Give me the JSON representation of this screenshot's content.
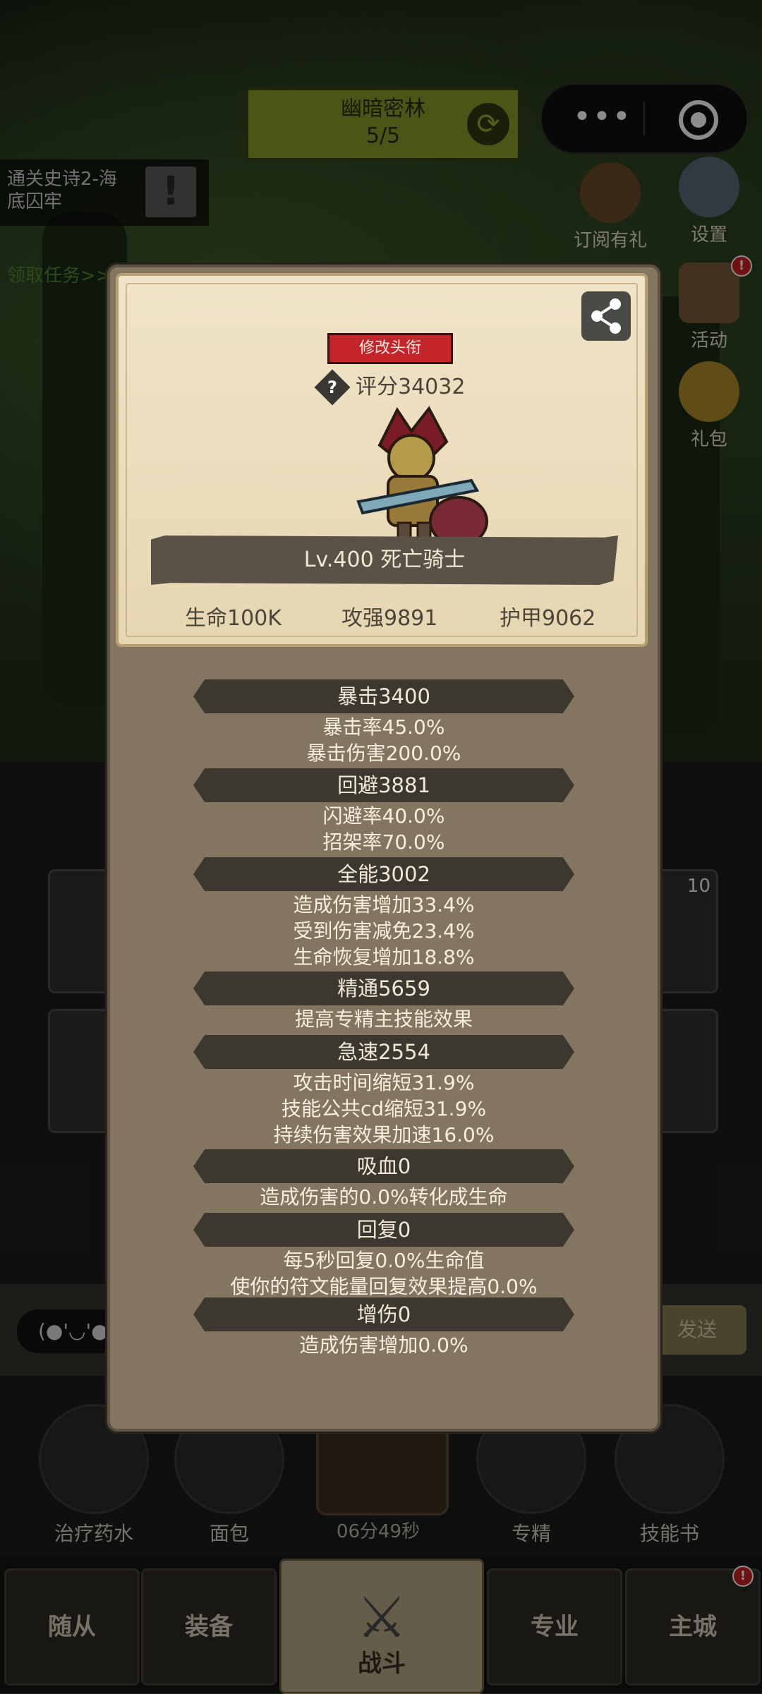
{
  "stage": {
    "name": "幽暗密林",
    "progress": "5/5"
  },
  "quest": {
    "line1": "通关史诗2-海",
    "line2": "底囚牢",
    "link": "领取任务>>"
  },
  "side_buttons": [
    {
      "label": "订阅有礼"
    },
    {
      "label": "设置"
    },
    {
      "label": "活动"
    },
    {
      "label": "礼包"
    }
  ],
  "chat": {
    "emoji": "(●'◡'●",
    "send": "发送"
  },
  "item_badge": "10",
  "bottom_items": [
    {
      "label": "治疗药水"
    },
    {
      "label": "面包"
    },
    {
      "label": "专精"
    },
    {
      "label": "技能书"
    }
  ],
  "timer": "06分49秒",
  "tabs": [
    {
      "label": "随从"
    },
    {
      "label": "装备"
    },
    {
      "label": "战斗"
    },
    {
      "label": "专业"
    },
    {
      "label": "主城"
    }
  ],
  "profile": {
    "title_button": "修改头衔",
    "score": "评分34032",
    "name": "Lv.400 死亡骑士",
    "hp": "生命100K",
    "attack": "攻强9891",
    "armor": "护甲9062"
  },
  "stats": [
    {
      "name": "暴击3400",
      "lines": [
        "暴击率45.0%",
        "暴击伤害200.0%"
      ]
    },
    {
      "name": "回避3881",
      "lines": [
        "闪避率40.0%",
        "招架率70.0%"
      ]
    },
    {
      "name": "全能3002",
      "lines": [
        "造成伤害增加33.4%",
        "受到伤害减免23.4%",
        "生命恢复增加18.8%"
      ]
    },
    {
      "name": "精通5659",
      "lines": [
        "提高专精主技能效果"
      ]
    },
    {
      "name": "急速2554",
      "lines": [
        "攻击时间缩短31.9%",
        "技能公共cd缩短31.9%",
        "持续伤害效果加速16.0%"
      ]
    },
    {
      "name": "吸血0",
      "lines": [
        "造成伤害的0.0%转化成生命"
      ]
    },
    {
      "name": "回复0",
      "lines": [
        "每5秒回复0.0%生命值",
        "使你的符文能量回复效果提高0.0%"
      ]
    },
    {
      "name": "增伤0",
      "lines": [
        "造成伤害增加0.0%"
      ]
    }
  ]
}
